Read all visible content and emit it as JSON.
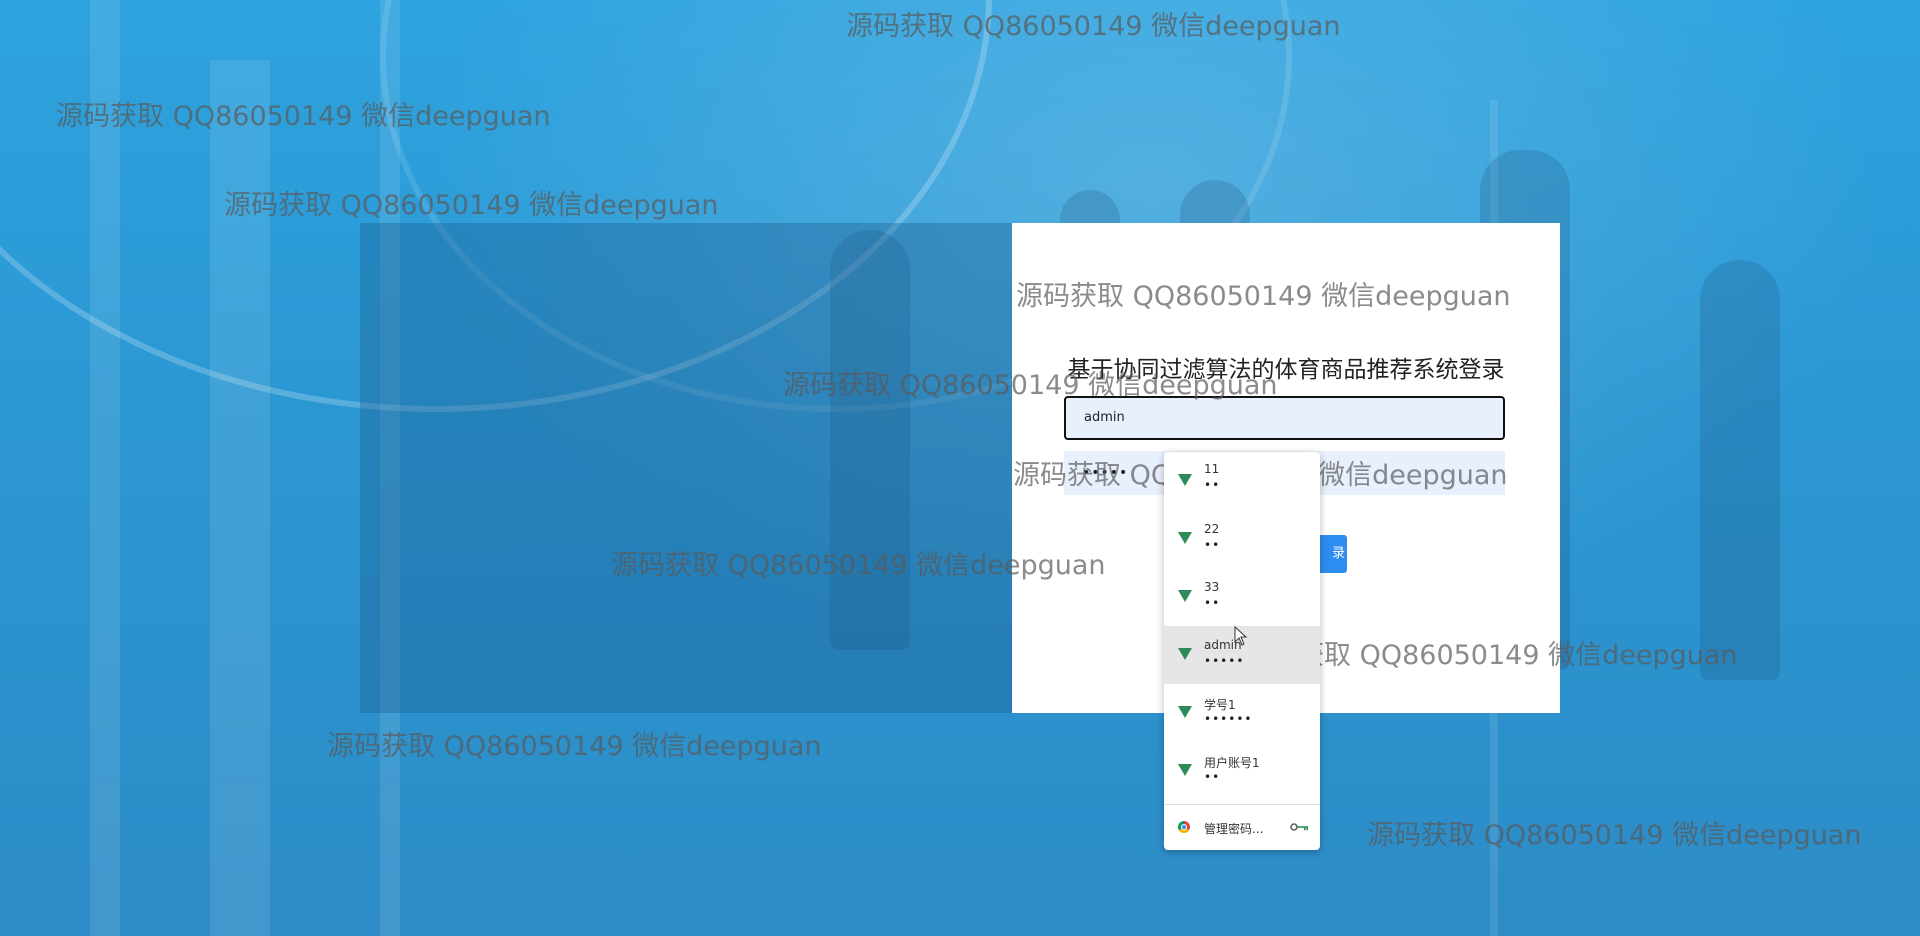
{
  "login": {
    "title": "基于协同过滤算法的体育商品推荐系统登录",
    "username_value": "admin",
    "password_value": "•••••",
    "login_button_label": "录"
  },
  "watermark_text": "源码获取 QQ86050149 微信deepguan",
  "autocomplete": {
    "items": [
      {
        "user": "11",
        "dots": "••"
      },
      {
        "user": "22",
        "dots": "••"
      },
      {
        "user": "33",
        "dots": "••"
      },
      {
        "user": "admin",
        "dots": "•••••"
      },
      {
        "user": "学号1",
        "dots": "••••••"
      },
      {
        "user": "用户账号1",
        "dots": "••"
      }
    ],
    "manage_label": "管理密码..."
  }
}
